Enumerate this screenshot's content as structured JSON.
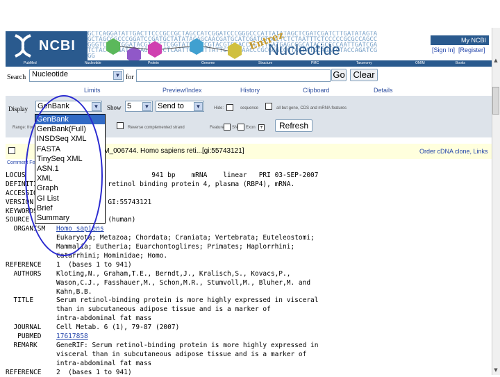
{
  "banner": {
    "logo": "NCBI",
    "title": "Nucleotide",
    "entrez": "Entrez",
    "dna_text": "GCTCAGGATATTGACTTCCCGCCGCTAGCCATCGGATCCCGGGCCCATTATATAGCTCGATCGATCTTGATATAGTAGCTAGCCGCCCGGATCCGATGCTATATACAGCAACGATGCATCGATCTGGCTCTCTAATTTCTCCCCCGCGCCAGCCGGGTCTTTCGGATACGTATCTCGGTATCGATCGTACGTCGACCAGTCTCATGAGCCGCATACGCCCCAATTGATCGATCTACTATGATGCCAGCAGCCTCAATTGATCTTATTCTACTAACCCGCGGGCGCTACTATGCAGATCTACCAGATCGGG",
    "my_ncbi": "My NCBI",
    "sign_in": "[Sign In]",
    "register": "[Register]"
  },
  "navbar": [
    "PubMed",
    "Nucleotide",
    "Protein",
    "Genome",
    "Structure",
    "PMC",
    "Taxonomy",
    "OMIM",
    "Books"
  ],
  "search": {
    "label": "Search",
    "db_value": "Nucleotide",
    "for_label": "for",
    "query": "",
    "go": "Go",
    "clear": "Clear"
  },
  "tabs": [
    "Limits",
    "Preview/Index",
    "History",
    "Clipboard",
    "Details"
  ],
  "display": {
    "label": "Display",
    "format": "GenBank",
    "show_label": "Show",
    "show_value": "5",
    "send_to": "Send to",
    "hide": "Hide:",
    "sequence": "sequence",
    "all_but": "all but gene, CDS and mRNA features",
    "range_label": "Range: from",
    "reverse": "Reverse complemented strand",
    "features": "Features:",
    "snp": "SNP",
    "exon": "Exon",
    "refresh": "Refresh"
  },
  "format_options": [
    "GenBank",
    "GenBank(Full)",
    "INSDSeq XML",
    "FASTA",
    "TinySeq XML",
    "ASN.1",
    "XML",
    "Graph",
    "GI List",
    "Brief",
    "Summary"
  ],
  "record_header": {
    "title": "NM_006744. Homo sapiens reti...[gi:55743121]",
    "order": "Order cDNA clone, Links",
    "sublinks": "Comment  Features  Sequence"
  },
  "genbank": [
    {
      "k": "LOCUS",
      "v": "NM_006744               941 bp    mRNA    linear   PRI 03-SEP-2007"
    },
    {
      "k": "DEFINITION",
      "v": "Homo sapiens retinol binding protein 4, plasma (RBP4), mRNA."
    },
    {
      "k": "ACCESSION",
      "v": "NM_006744"
    },
    {
      "k": "VERSION",
      "v": "NM_006744.3  GI:55743121"
    },
    {
      "k": "KEYWORDS",
      "v": "."
    },
    {
      "k": "SOURCE",
      "v": "Homo sapiens (human)"
    },
    {
      "k": "  ORGANISM",
      "v": "Homo sapiens",
      "link": true
    },
    {
      "k": "",
      "v": "Eukaryota; Metazoa; Chordata; Craniata; Vertebrata; Euteleostomi;"
    },
    {
      "k": "",
      "v": "Mammalia; Eutheria; Euarchontoglires; Primates; Haplorrhini;"
    },
    {
      "k": "",
      "v": "Catarrhini; Hominidae; Homo."
    },
    {
      "k": "REFERENCE",
      "v": "1  (bases 1 to 941)"
    },
    {
      "k": "  AUTHORS",
      "v": "Kloting,N., Graham,T.E., Berndt,J., Kralisch,S., Kovacs,P.,"
    },
    {
      "k": "",
      "v": "Wason,C.J., Fasshauer,M., Schon,M.R., Stumvoll,M., Bluher,M. and"
    },
    {
      "k": "",
      "v": "Kahn,B.B."
    },
    {
      "k": "  TITLE",
      "v": "Serum retinol-binding protein is more highly expressed in visceral"
    },
    {
      "k": "",
      "v": "than in subcutaneous adipose tissue and is a marker of"
    },
    {
      "k": "",
      "v": "intra-abdominal fat mass"
    },
    {
      "k": "  JOURNAL",
      "v": "Cell Metab. 6 (1), 79-87 (2007)"
    },
    {
      "k": "   PUBMED",
      "v": "17617858",
      "link": true
    },
    {
      "k": "  REMARK",
      "v": "GeneRIF: Serum retinol-binding protein is more highly expressed in"
    },
    {
      "k": "",
      "v": "visceral than in subcutaneous adipose tissue and is a marker of"
    },
    {
      "k": "",
      "v": "intra-abdominal fat mass"
    },
    {
      "k": "REFERENCE",
      "v": "2  (bases 1 to 941)"
    }
  ],
  "colors": {
    "ncbi_blue": "#2a5a8e",
    "selection": "#316ac5",
    "annotation": "#2a2ad0"
  }
}
